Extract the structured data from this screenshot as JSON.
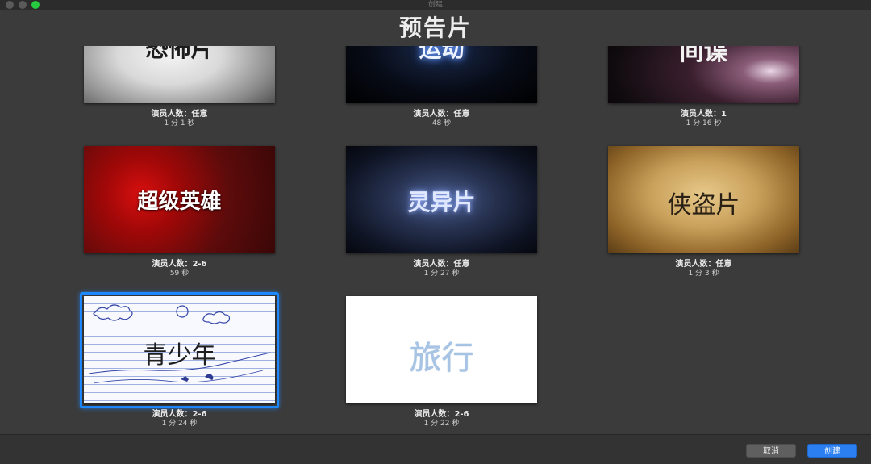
{
  "window": {
    "title": "创建"
  },
  "heading": "预告片",
  "trailers": [
    {
      "name": "恐怖片",
      "cast": "演员人数：任意",
      "duration": "1 分 1 秒"
    },
    {
      "name": "运动",
      "cast": "演员人数：任意",
      "duration": "48 秒"
    },
    {
      "name": "间谍",
      "cast": "演员人数：1",
      "duration": "1 分 16 秒"
    },
    {
      "name": "超级英雄",
      "cast": "演员人数：2-6",
      "duration": "59 秒"
    },
    {
      "name": "灵异片",
      "cast": "演员人数：任意",
      "duration": "1 分 27 秒"
    },
    {
      "name": "侠盗片",
      "cast": "演员人数：任意",
      "duration": "1 分 3 秒"
    },
    {
      "name": "青少年",
      "cast": "演员人数：2-6",
      "duration": "1 分 24 秒"
    },
    {
      "name": "旅行",
      "cast": "演员人数：2-6",
      "duration": "1 分 22 秒"
    }
  ],
  "footer": {
    "cancel_label": "取消",
    "create_label": "创建"
  },
  "colors": {
    "accent": "#2b7ff0",
    "selection": "#1e88ff"
  }
}
